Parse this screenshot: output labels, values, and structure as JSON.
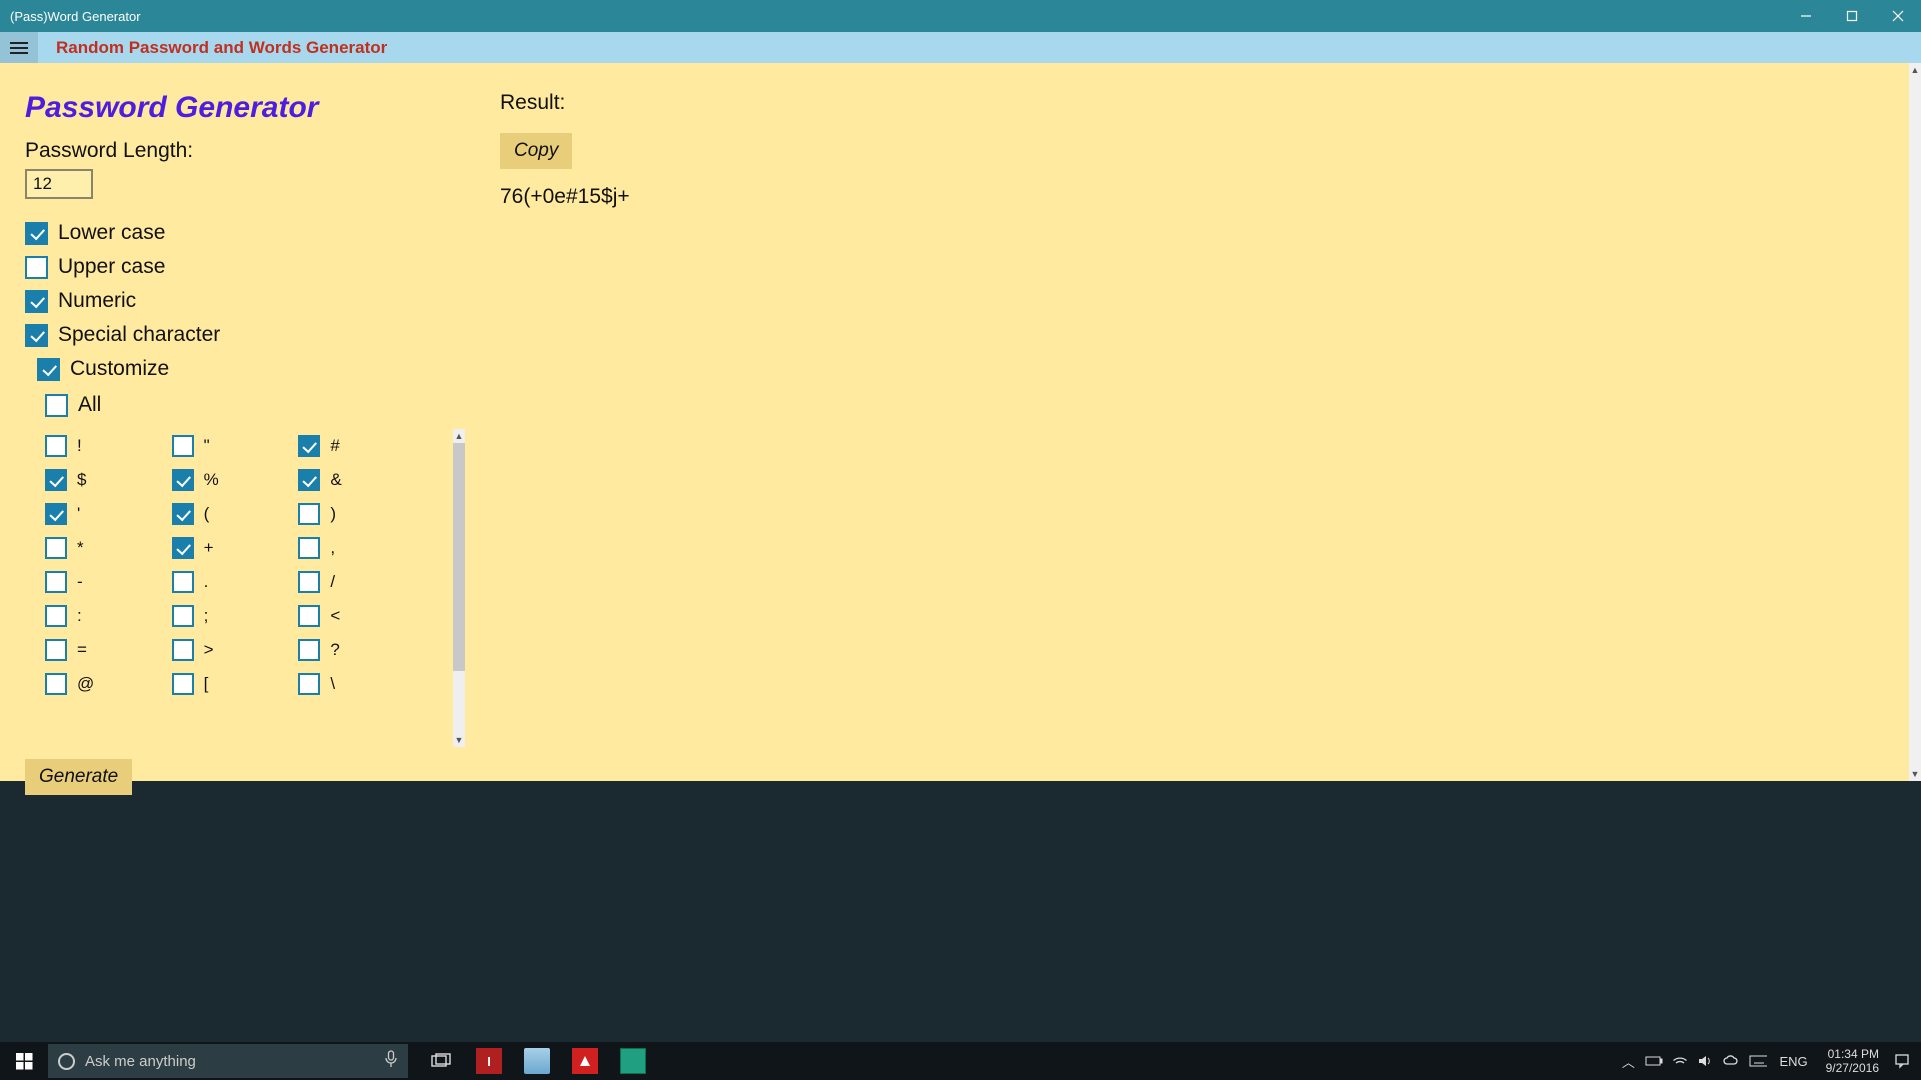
{
  "window": {
    "title": "(Pass)Word Generator"
  },
  "header": {
    "subtitle": "Random Password and Words Generator"
  },
  "left": {
    "section_title": "Password Generator",
    "length_label": "Password Length:",
    "length_value": "12",
    "opt_lower": "Lower case",
    "opt_upper": "Upper case",
    "opt_numeric": "Numeric",
    "opt_special": "Special character",
    "opt_customize": "Customize",
    "opt_all": "All",
    "generate": "Generate"
  },
  "special_chars": {
    "col1": [
      {
        "sym": "!",
        "checked": false
      },
      {
        "sym": "$",
        "checked": true
      },
      {
        "sym": "'",
        "checked": true
      },
      {
        "sym": "*",
        "checked": false
      },
      {
        "sym": "-",
        "checked": false
      },
      {
        "sym": ":",
        "checked": false
      },
      {
        "sym": "=",
        "checked": false
      },
      {
        "sym": "@",
        "checked": false
      }
    ],
    "col2": [
      {
        "sym": "\"",
        "checked": false
      },
      {
        "sym": "%",
        "checked": true
      },
      {
        "sym": "(",
        "checked": true
      },
      {
        "sym": "+",
        "checked": true
      },
      {
        "sym": ".",
        "checked": false
      },
      {
        "sym": ";",
        "checked": false
      },
      {
        "sym": ">",
        "checked": false
      },
      {
        "sym": "[",
        "checked": false
      }
    ],
    "col3": [
      {
        "sym": "#",
        "checked": true
      },
      {
        "sym": "&",
        "checked": true
      },
      {
        "sym": ")",
        "checked": false
      },
      {
        "sym": ",",
        "checked": false
      },
      {
        "sym": "/",
        "checked": false
      },
      {
        "sym": "<",
        "checked": false
      },
      {
        "sym": "?",
        "checked": false
      },
      {
        "sym": "\\",
        "checked": false
      }
    ]
  },
  "right": {
    "result_label": "Result:",
    "copy": "Copy",
    "result": "76(+0e#15$j+"
  },
  "taskbar": {
    "search_placeholder": "Ask me anything",
    "lang": "ENG",
    "time": "01:34 PM",
    "date": "9/27/2016"
  }
}
